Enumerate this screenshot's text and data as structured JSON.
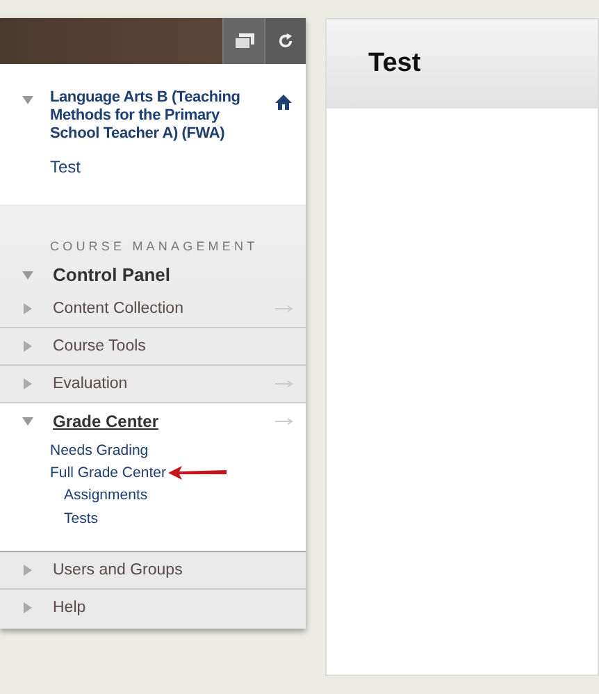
{
  "course": {
    "title": "Language Arts B (Teaching Methods for the Primary School Teacher A) (FWA)",
    "expanded": true,
    "links": [
      "Test"
    ]
  },
  "section_label": "COURSE MANAGEMENT",
  "control_panel": {
    "label": "Control Panel",
    "expanded": true,
    "items": [
      {
        "label": "Content Collection",
        "expanded": false,
        "link_arrow": true
      },
      {
        "label": "Course Tools",
        "expanded": false,
        "link_arrow": false
      },
      {
        "label": "Evaluation",
        "expanded": false,
        "link_arrow": true
      },
      {
        "label": "Grade Center",
        "expanded": true,
        "link_arrow": true,
        "children": [
          {
            "label": "Needs Grading",
            "pointer": false
          },
          {
            "label": "Full Grade Center",
            "pointer": true,
            "children": [
              {
                "label": "Assignments"
              },
              {
                "label": "Tests"
              }
            ]
          }
        ]
      }
    ]
  },
  "bottom_items": [
    {
      "label": "Users and Groups",
      "expanded": false
    },
    {
      "label": "Help",
      "expanded": false
    }
  ],
  "page": {
    "title": "Test"
  }
}
